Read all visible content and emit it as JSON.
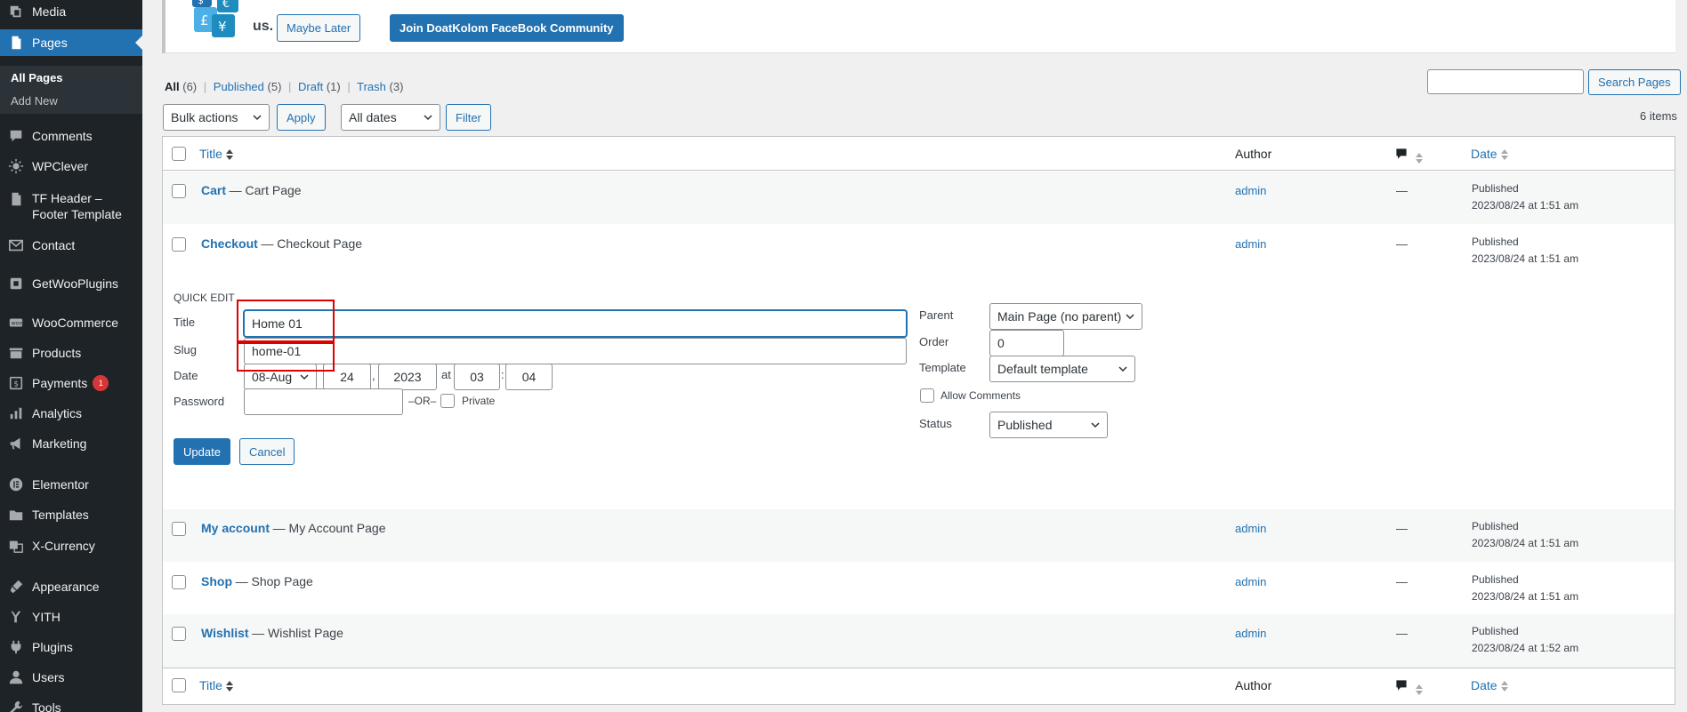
{
  "sidebar": {
    "items": [
      {
        "label": "Media",
        "icon": "media-icon"
      },
      {
        "label": "Pages",
        "icon": "pages-icon",
        "current": true
      },
      {
        "label": "Comments",
        "icon": "comments-icon"
      },
      {
        "label": "WPClever",
        "icon": "wpclever-icon"
      },
      {
        "label": "TF Header –",
        "label2": "Footer Template",
        "icon": "tf-header-icon"
      },
      {
        "label": "Contact",
        "icon": "contact-icon"
      },
      {
        "label": "GetWooPlugins",
        "icon": "getwooplugins-icon"
      },
      {
        "label": "WooCommerce",
        "icon": "woocommerce-icon"
      },
      {
        "label": "Products",
        "icon": "products-icon"
      },
      {
        "label": "Payments",
        "icon": "payments-icon",
        "badge": "1"
      },
      {
        "label": "Analytics",
        "icon": "analytics-icon"
      },
      {
        "label": "Marketing",
        "icon": "marketing-icon"
      },
      {
        "label": "Elementor",
        "icon": "elementor-icon"
      },
      {
        "label": "Templates",
        "icon": "templates-icon"
      },
      {
        "label": "X-Currency",
        "icon": "x-currency-icon"
      },
      {
        "label": "Appearance",
        "icon": "appearance-icon"
      },
      {
        "label": "YITH",
        "icon": "yith-icon"
      },
      {
        "label": "Plugins",
        "icon": "plugins-icon"
      },
      {
        "label": "Users",
        "icon": "users-icon"
      },
      {
        "label": "Tools",
        "icon": "tools-icon"
      }
    ],
    "submenu": [
      "All Pages",
      "Add New"
    ]
  },
  "notice": {
    "text": "us.",
    "maybe_later": "Maybe Later",
    "join": "Join DoatKolom FaceBook Community"
  },
  "filters": {
    "all_label": "All",
    "all_count": "(6)",
    "published_label": "Published",
    "published_count": "(5)",
    "draft_label": "Draft",
    "draft_count": "(1)",
    "trash_label": "Trash",
    "trash_count": "(3)",
    "sep": "|"
  },
  "search": {
    "value": "",
    "button": "Search Pages"
  },
  "bulk": {
    "bulk_actions": "Bulk actions",
    "apply": "Apply",
    "all_dates": "All dates",
    "filter": "Filter",
    "items_count": "6 items"
  },
  "table": {
    "col_title": "Title",
    "col_author": "Author",
    "col_date": "Date",
    "rows": [
      {
        "title": "Cart",
        "suffix": "— Cart Page",
        "author": "admin",
        "comments": "—",
        "status": "Published",
        "date": "2023/08/24 at 1:51 am"
      },
      {
        "title": "Checkout",
        "suffix": "— Checkout Page",
        "author": "admin",
        "comments": "—",
        "status": "Published",
        "date": "2023/08/24 at 1:51 am"
      },
      {
        "title": "My account",
        "suffix": "— My Account Page",
        "author": "admin",
        "comments": "—",
        "status": "Published",
        "date": "2023/08/24 at 1:51 am"
      },
      {
        "title": "Shop",
        "suffix": "— Shop Page",
        "author": "admin",
        "comments": "—",
        "status": "Published",
        "date": "2023/08/24 at 1:51 am"
      },
      {
        "title": "Wishlist",
        "suffix": "— Wishlist Page",
        "author": "admin",
        "comments": "—",
        "status": "Published",
        "date": "2023/08/24 at 1:52 am"
      }
    ]
  },
  "quick_edit": {
    "heading": "QUICK EDIT",
    "title_label": "Title",
    "title_value": "Home 01",
    "slug_label": "Slug",
    "slug_value": "home-01",
    "date_label": "Date",
    "month": "08-Aug",
    "day": "24",
    "comma": ",",
    "year": "2023",
    "at": "at",
    "hour": "03",
    "colon": ":",
    "minute": "04",
    "password_label": "Password",
    "or_label": "–OR–",
    "private_label": "Private",
    "parent_label": "Parent",
    "parent_value": "Main Page (no parent)",
    "order_label": "Order",
    "order_value": "0",
    "template_label": "Template",
    "template_value": "Default template",
    "allow_comments": "Allow Comments",
    "status_label": "Status",
    "status_value": "Published",
    "update": "Update",
    "cancel": "Cancel"
  },
  "colors": {
    "accent": "#2271b1",
    "sidebar_bg": "#1d2327",
    "highlight": "#e00000"
  }
}
